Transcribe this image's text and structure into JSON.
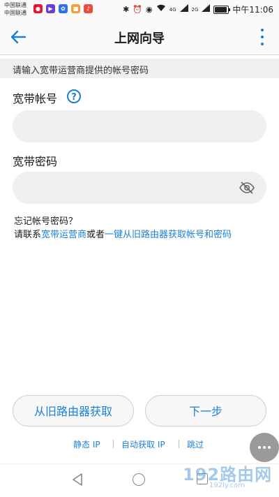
{
  "status_bar": {
    "carrier1": "中国联通",
    "carrier2": "中国联通",
    "network_label1": "4G",
    "network_label2": "2G",
    "time": "中午11:06",
    "battery_fraction": 0.85,
    "icons": [
      "weibo-icon",
      "video-icon",
      "baidu-icon",
      "app-icon",
      "music-icon",
      "bluetooth-icon",
      "alarm-icon",
      "eye-icon",
      "wifi-icon",
      "signal-icon",
      "battery-icon"
    ]
  },
  "app_bar": {
    "title": "上网向导"
  },
  "hint": "请输入宽带运营商提供的帐号密码",
  "account": {
    "label": "宽带帐号",
    "value": "",
    "help_glyph": "?"
  },
  "password": {
    "label": "宽带密码",
    "value": ""
  },
  "forgot": {
    "line1": "忘记帐号密码？",
    "prefix": "请联系",
    "link1": "宽带运营商",
    "middle": "或者",
    "link2": "一键从旧路由器获取帐号和密码"
  },
  "buttons": {
    "from_old": "从旧路由器获取",
    "next": "下一步"
  },
  "bottom_links": {
    "static_ip": "静态 IP",
    "auto_ip": "自动获取 IP",
    "skip": "跳过"
  },
  "watermark": {
    "main": "192路由网",
    "sub": "192ly.com"
  },
  "colors": {
    "accent": "#1b7fd6",
    "field_bg": "#efefef",
    "hint_bg": "#efefef"
  }
}
